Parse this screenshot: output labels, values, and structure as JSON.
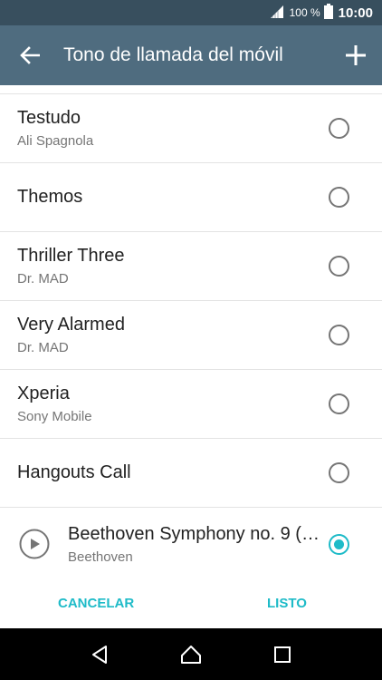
{
  "status_bar": {
    "battery_percent": "100 %",
    "time": "10:00",
    "icons": [
      "signal-icon",
      "battery-icon"
    ]
  },
  "app_bar": {
    "title": "Tono de llamada del móvil",
    "icons": [
      "back-arrow-icon",
      "add-icon"
    ]
  },
  "ringtones": [
    {
      "name": "Testudo",
      "artist": "Ali Spagnola",
      "selected": false
    },
    {
      "name": "Themos",
      "artist": "",
      "selected": false
    },
    {
      "name": "Thriller Three",
      "artist": "Dr. MAD",
      "selected": false
    },
    {
      "name": "Very Alarmed",
      "artist": "Dr. MAD",
      "selected": false
    },
    {
      "name": "Xperia",
      "artist": "Sony Mobile",
      "selected": false
    },
    {
      "name": "Hangouts Call",
      "artist": "",
      "selected": false
    }
  ],
  "now_playing": {
    "name": "Beethoven Symphony no. 9 (…",
    "artist": "Beethoven",
    "selected": true,
    "icon": "play-icon"
  },
  "actions": {
    "cancel_label": "CANCELAR",
    "ok_label": "LISTO"
  },
  "nav_bar": {
    "icons": [
      "back-triangle-icon",
      "home-icon",
      "recents-icon"
    ]
  },
  "colors": {
    "status_bar": "#384f5e",
    "app_bar": "#4f6c7f",
    "accent": "#1ebbc8"
  }
}
